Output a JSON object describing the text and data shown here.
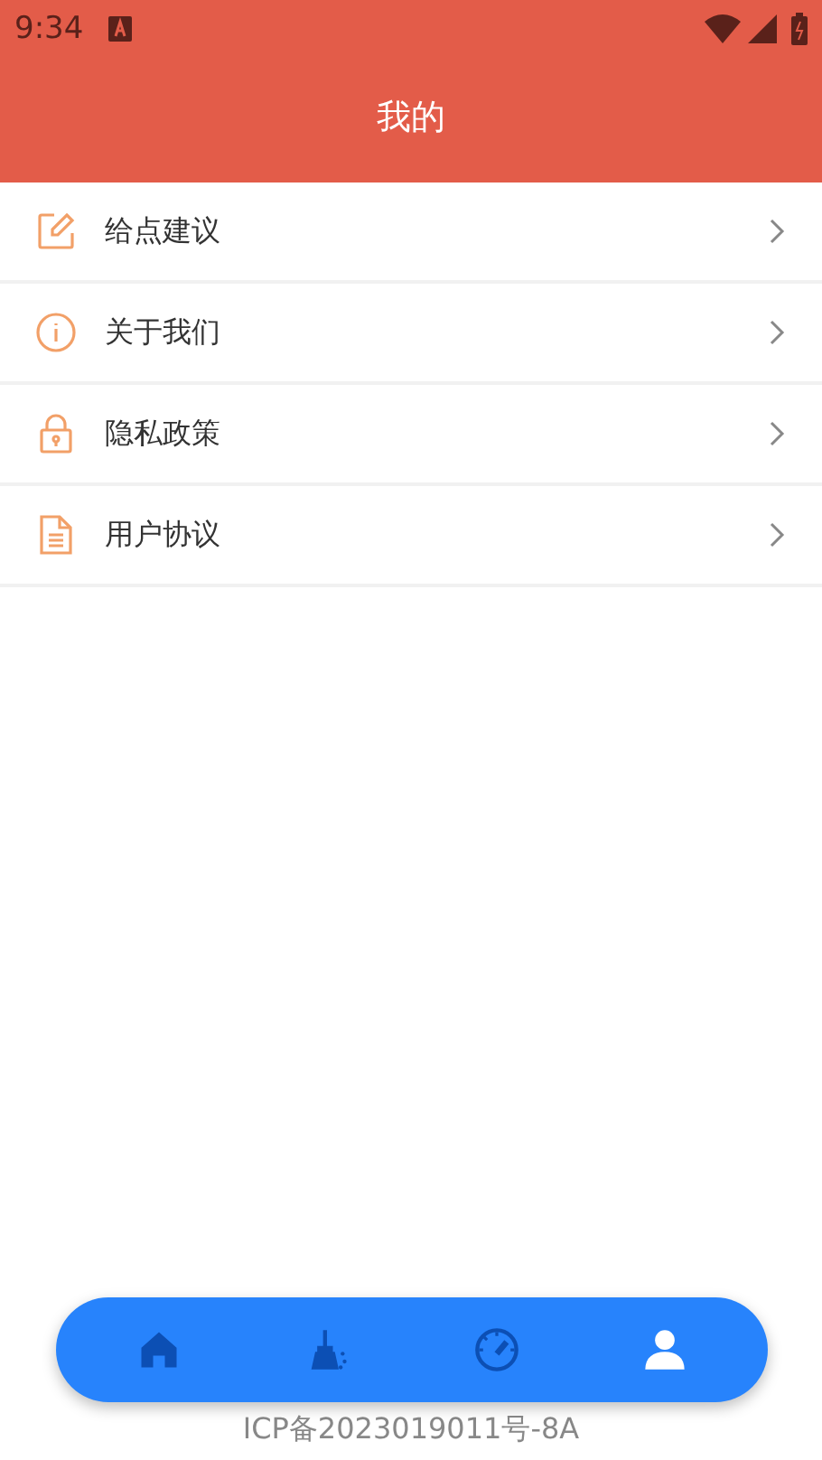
{
  "status_bar": {
    "time": "9:34"
  },
  "header": {
    "title": "我的"
  },
  "menu": [
    {
      "kind": "edit",
      "label": "给点建议"
    },
    {
      "kind": "info",
      "label": "关于我们"
    },
    {
      "kind": "lock",
      "label": "隐私政策"
    },
    {
      "kind": "doc",
      "label": "用户协议"
    }
  ],
  "footer": {
    "text": "ICP备2023019011号-8A"
  },
  "bottom_nav": [
    {
      "kind": "home",
      "selected": false
    },
    {
      "kind": "clean",
      "selected": false
    },
    {
      "kind": "speed",
      "selected": false
    },
    {
      "kind": "profile",
      "selected": true
    }
  ]
}
